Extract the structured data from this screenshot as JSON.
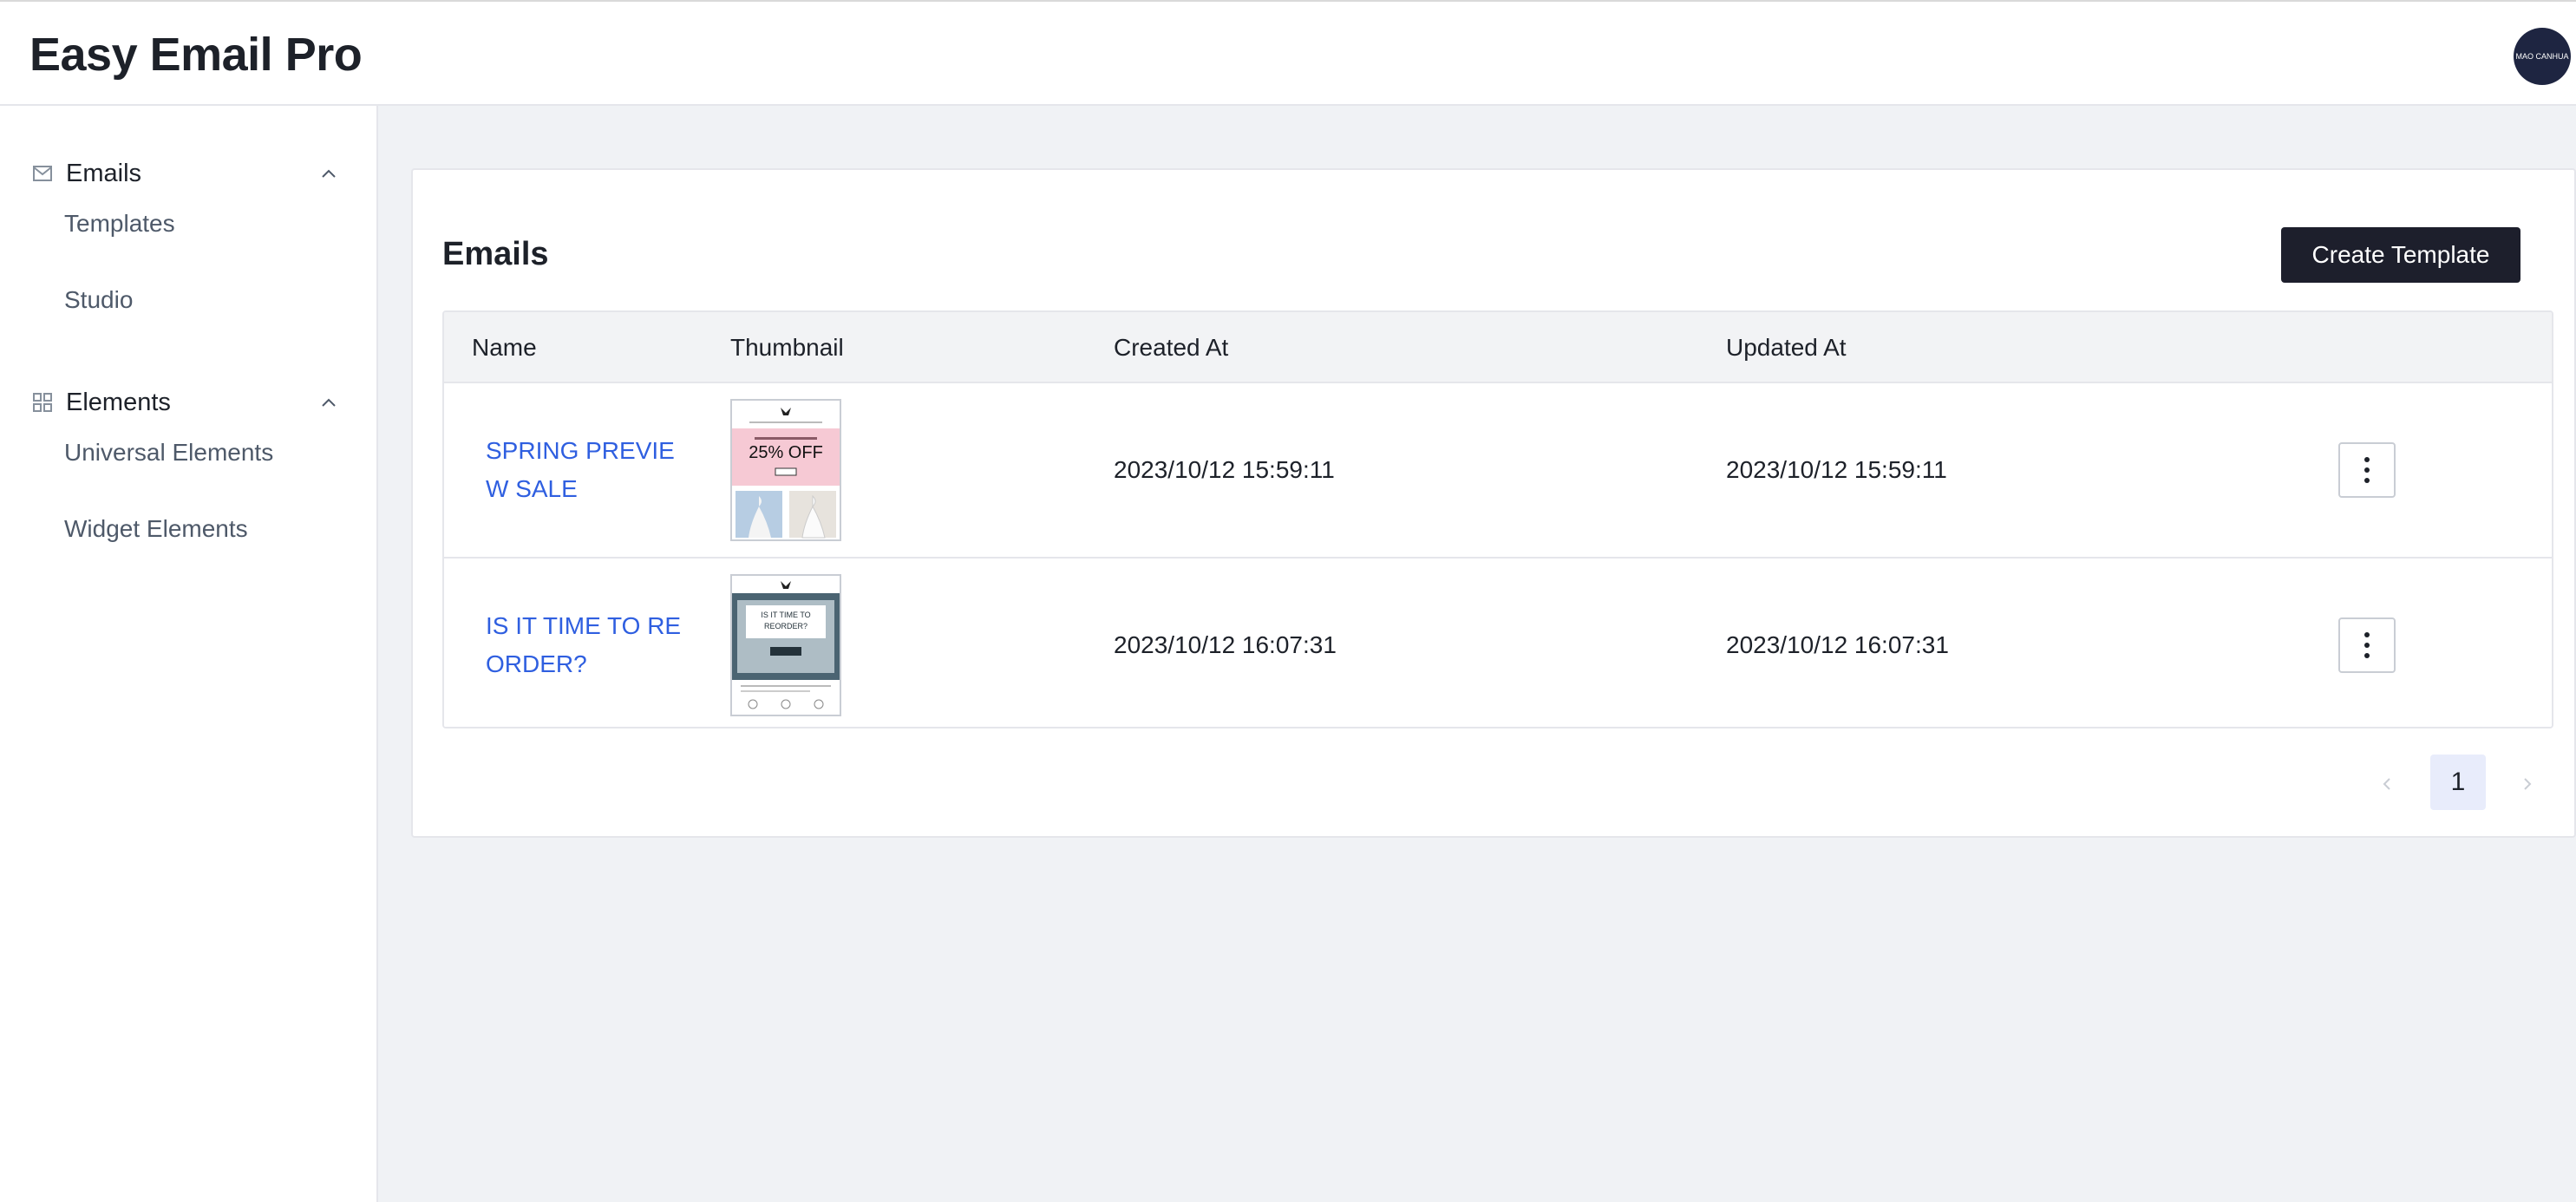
{
  "header": {
    "app_title": "Easy Email Pro",
    "avatar_text": "MAO CANHUA"
  },
  "sidebar": {
    "groups": [
      {
        "label": "Emails",
        "icon": "mail-icon",
        "expanded": true,
        "items": [
          {
            "label": "Templates"
          },
          {
            "label": "Studio"
          }
        ]
      },
      {
        "label": "Elements",
        "icon": "grid-icon",
        "expanded": true,
        "items": [
          {
            "label": "Universal Elements"
          },
          {
            "label": "Widget Elements"
          }
        ]
      }
    ]
  },
  "main": {
    "title": "Emails",
    "create_label": "Create Template",
    "columns": [
      "Name",
      "Thumbnail",
      "Created At",
      "Updated At"
    ],
    "rows": [
      {
        "name": "SPRING PREVIEW SALE",
        "thumbnail": {
          "headline": "25% OFF",
          "accent": "#f6c9d4"
        },
        "created_at": "2023/10/12 15:59:11",
        "updated_at": "2023/10/12 15:59:11"
      },
      {
        "name": "IS IT TIME TO REORDER?",
        "thumbnail": {
          "headline": "IS IT TIME TO REORDER?",
          "accent": "#4b6472"
        },
        "created_at": "2023/10/12 16:07:31",
        "updated_at": "2023/10/12 16:07:31"
      }
    ],
    "pagination": {
      "current_page": "1"
    }
  },
  "colors": {
    "accent_link": "#2f5fe0",
    "primary_button": "#1d1f2c",
    "avatar_bg": "#1e2541",
    "page_bg": "#f0f2f5"
  }
}
